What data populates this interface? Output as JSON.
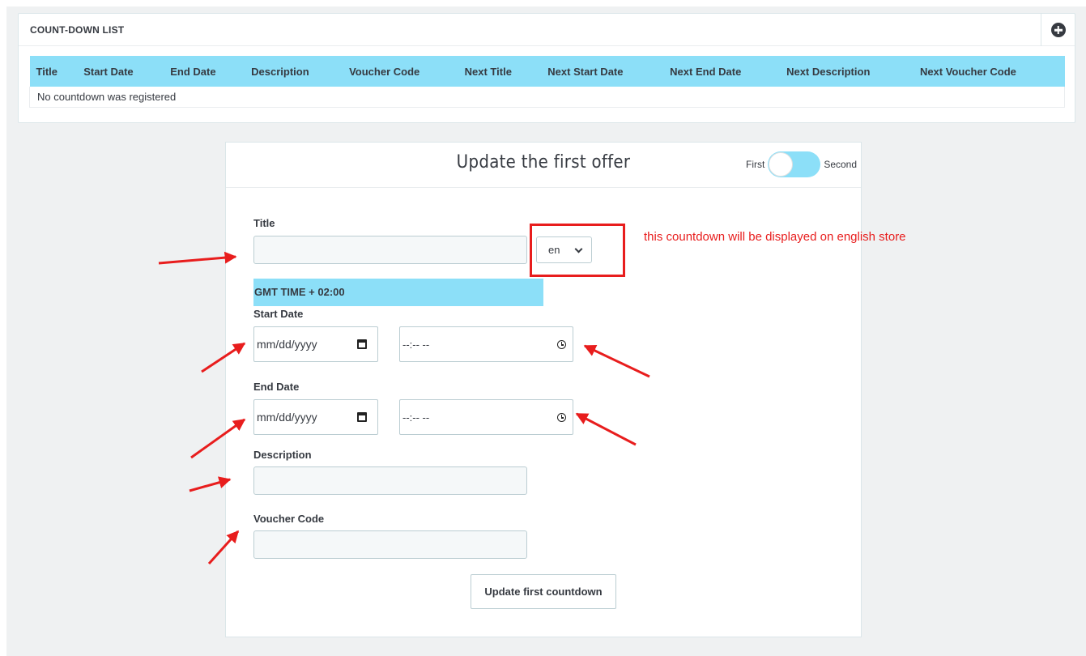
{
  "countdown_list": {
    "header": "COUNT-DOWN LIST",
    "add_icon": "plus-circle-icon",
    "columns": [
      "Title",
      "Start Date",
      "End Date",
      "Description",
      "Voucher Code",
      "Next Title",
      "Next Start Date",
      "Next End Date",
      "Next Description",
      "Next Voucher Code"
    ],
    "empty_message": "No countdown was registered"
  },
  "form": {
    "title": "Update the first offer",
    "toggle": {
      "left_label": "First",
      "right_label": "Second"
    },
    "title_label": "Title",
    "title_value": "",
    "language_select": "en",
    "gmt_banner": "GMT TIME + 02:00",
    "start_date_label": "Start Date",
    "start_date_placeholder": "mm/dd/yyyy",
    "start_time_placeholder": "--:-- --",
    "end_date_label": "End Date",
    "end_date_placeholder": "mm/dd/yyyy",
    "end_time_placeholder": "--:-- --",
    "description_label": "Description",
    "voucher_label": "Voucher Code",
    "submit_label": "Update first countdown"
  },
  "annotation": {
    "note": "this countdown will be displayed on english store",
    "color": "#e81d1d"
  },
  "colors": {
    "accent": "#8cdff8",
    "page_bg": "#eff1f2",
    "text": "#363a41"
  }
}
